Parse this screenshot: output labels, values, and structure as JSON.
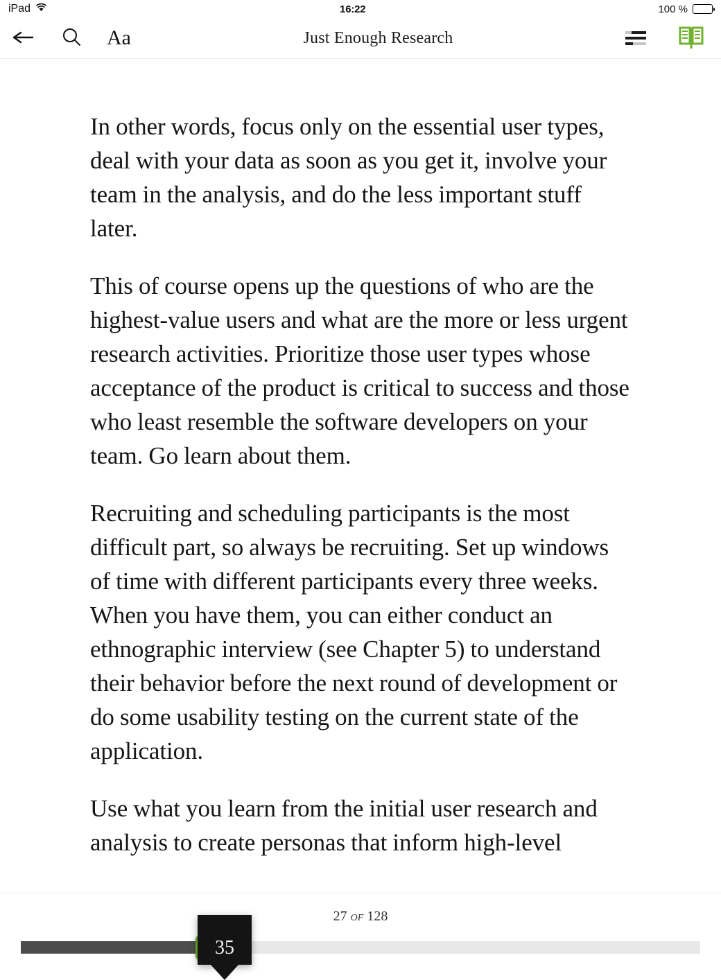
{
  "status_bar": {
    "device": "iPad",
    "wifi_icon": "wifi-icon",
    "time": "16:22",
    "battery_percent": "100 %",
    "battery_icon": "battery-full-icon"
  },
  "toolbar": {
    "back_icon": "arrow-left-icon",
    "search_icon": "search-icon",
    "font_size_label": "Aa",
    "title": "Just Enough Research",
    "contents_icon": "table-of-contents-icon",
    "library_icon": "open-book-icon",
    "accent_color": "#6fb22d"
  },
  "content": {
    "paragraphs": [
      "In other words, focus only on the essential user types, deal with your data as soon as you get it, involve your team in the analysis, and do the less important stuff later.",
      "This of course opens up the questions of who are the highest-value users and what are the more or less urgent research activities. Prioritize those user types whose acceptance of the product is critical to success and those who least resemble the software developers on your team. Go learn about them.",
      "Recruiting and scheduling participants is the most difficult part, so always be recruiting. Set up windows of time with different participants every three weeks. When you have them, you can either conduct an ethnographic interview (see Chapter 5) to understand their behavior before the next round of development or do some usability testing on the current state of the application.",
      "Use what you learn from the initial user research and analysis to create personas that inform high-level"
    ]
  },
  "footer": {
    "page_bubble_value": "35",
    "page_current": "27",
    "page_of_word": "of",
    "page_total": "128",
    "slider": {
      "value_percent": 26,
      "track_color": "#e8e8e8",
      "fill_color": "#4c4c4c",
      "thumb_color": "#6fb22d"
    }
  }
}
